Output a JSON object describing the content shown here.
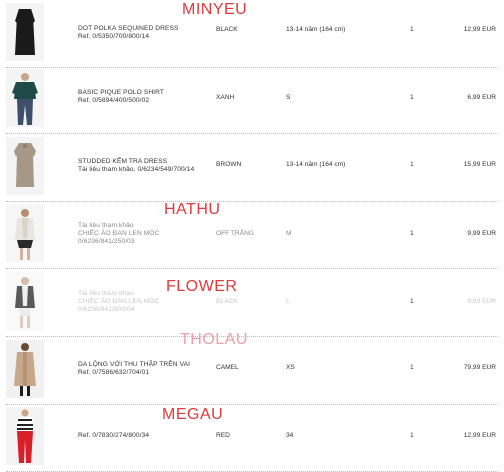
{
  "items": [
    {
      "name_lines": [
        "DOT POLKA SEQUINED DRESS",
        "Ref. 0/5350/700/800/14"
      ],
      "color": "BLACK",
      "size": "13-14 năm (164 cm)",
      "qty": "1",
      "price": "12,99 EUR",
      "stamp": "MINYEU",
      "thumb_icon": "black-dress-thumbnail"
    },
    {
      "name_lines": [
        "BASIC PIQUE POLO SHIRT",
        "Ref. 0/5894/400/500/02"
      ],
      "color": "XANH",
      "size": "S",
      "qty": "1",
      "price": "6,99 EUR",
      "stamp": "",
      "thumb_icon": "green-polo-thumbnail"
    },
    {
      "name_lines": [
        "STUDDED KỂM TRA DRESS",
        "Tài liệu tham khảo. 0/6234/549/700/14"
      ],
      "color": "BROWN",
      "size": "13-14 năm (164 cm)",
      "qty": "1",
      "price": "15,99 EUR",
      "stamp": "",
      "thumb_icon": "brown-dress-thumbnail"
    },
    {
      "name_lines": [
        "Tài liệu tham khảo",
        "CHIẾC ÁO ĐAN LEN MÓC",
        "0/6236/841/250/03"
      ],
      "color": "OFF TRẮNG",
      "size": "M",
      "qty": "1",
      "price": "9,99 EUR",
      "stamp": "HATHU",
      "thumb_icon": "cardigan-white-thumbnail"
    },
    {
      "name_lines": [
        "Tài liệu tham khảo",
        "CHIẾC ÁO ĐAN LEN MÓC",
        "0/6236/841/800/04"
      ],
      "color": "BLACK",
      "size": "L",
      "qty": "1",
      "price": "9,99 EUR",
      "stamp": "FLOWER",
      "thumb_icon": "cardigan-black-thumbnail"
    },
    {
      "name_lines": [
        "DA LỘNG VỚI THU THẬP TRÊN VAI",
        "Ref. 0/7586/632/704/01"
      ],
      "color": "CAMEL",
      "size": "XS",
      "qty": "1",
      "price": "79,99 EUR",
      "stamp": "THOLAU",
      "thumb_icon": "camel-coat-thumbnail"
    },
    {
      "name_lines": [
        "Ref. 0/7830/274/800/34"
      ],
      "color": "RED",
      "size": "34",
      "qty": "1",
      "price": "12,99 EUR",
      "stamp": "MEGAU",
      "thumb_icon": "red-trousers-thumbnail"
    }
  ],
  "colors": {
    "stamp_red": "#e03a3e",
    "stamp_pale": "#ea9fa6",
    "text": "#333333",
    "faded_text": "#c6c6c6"
  }
}
